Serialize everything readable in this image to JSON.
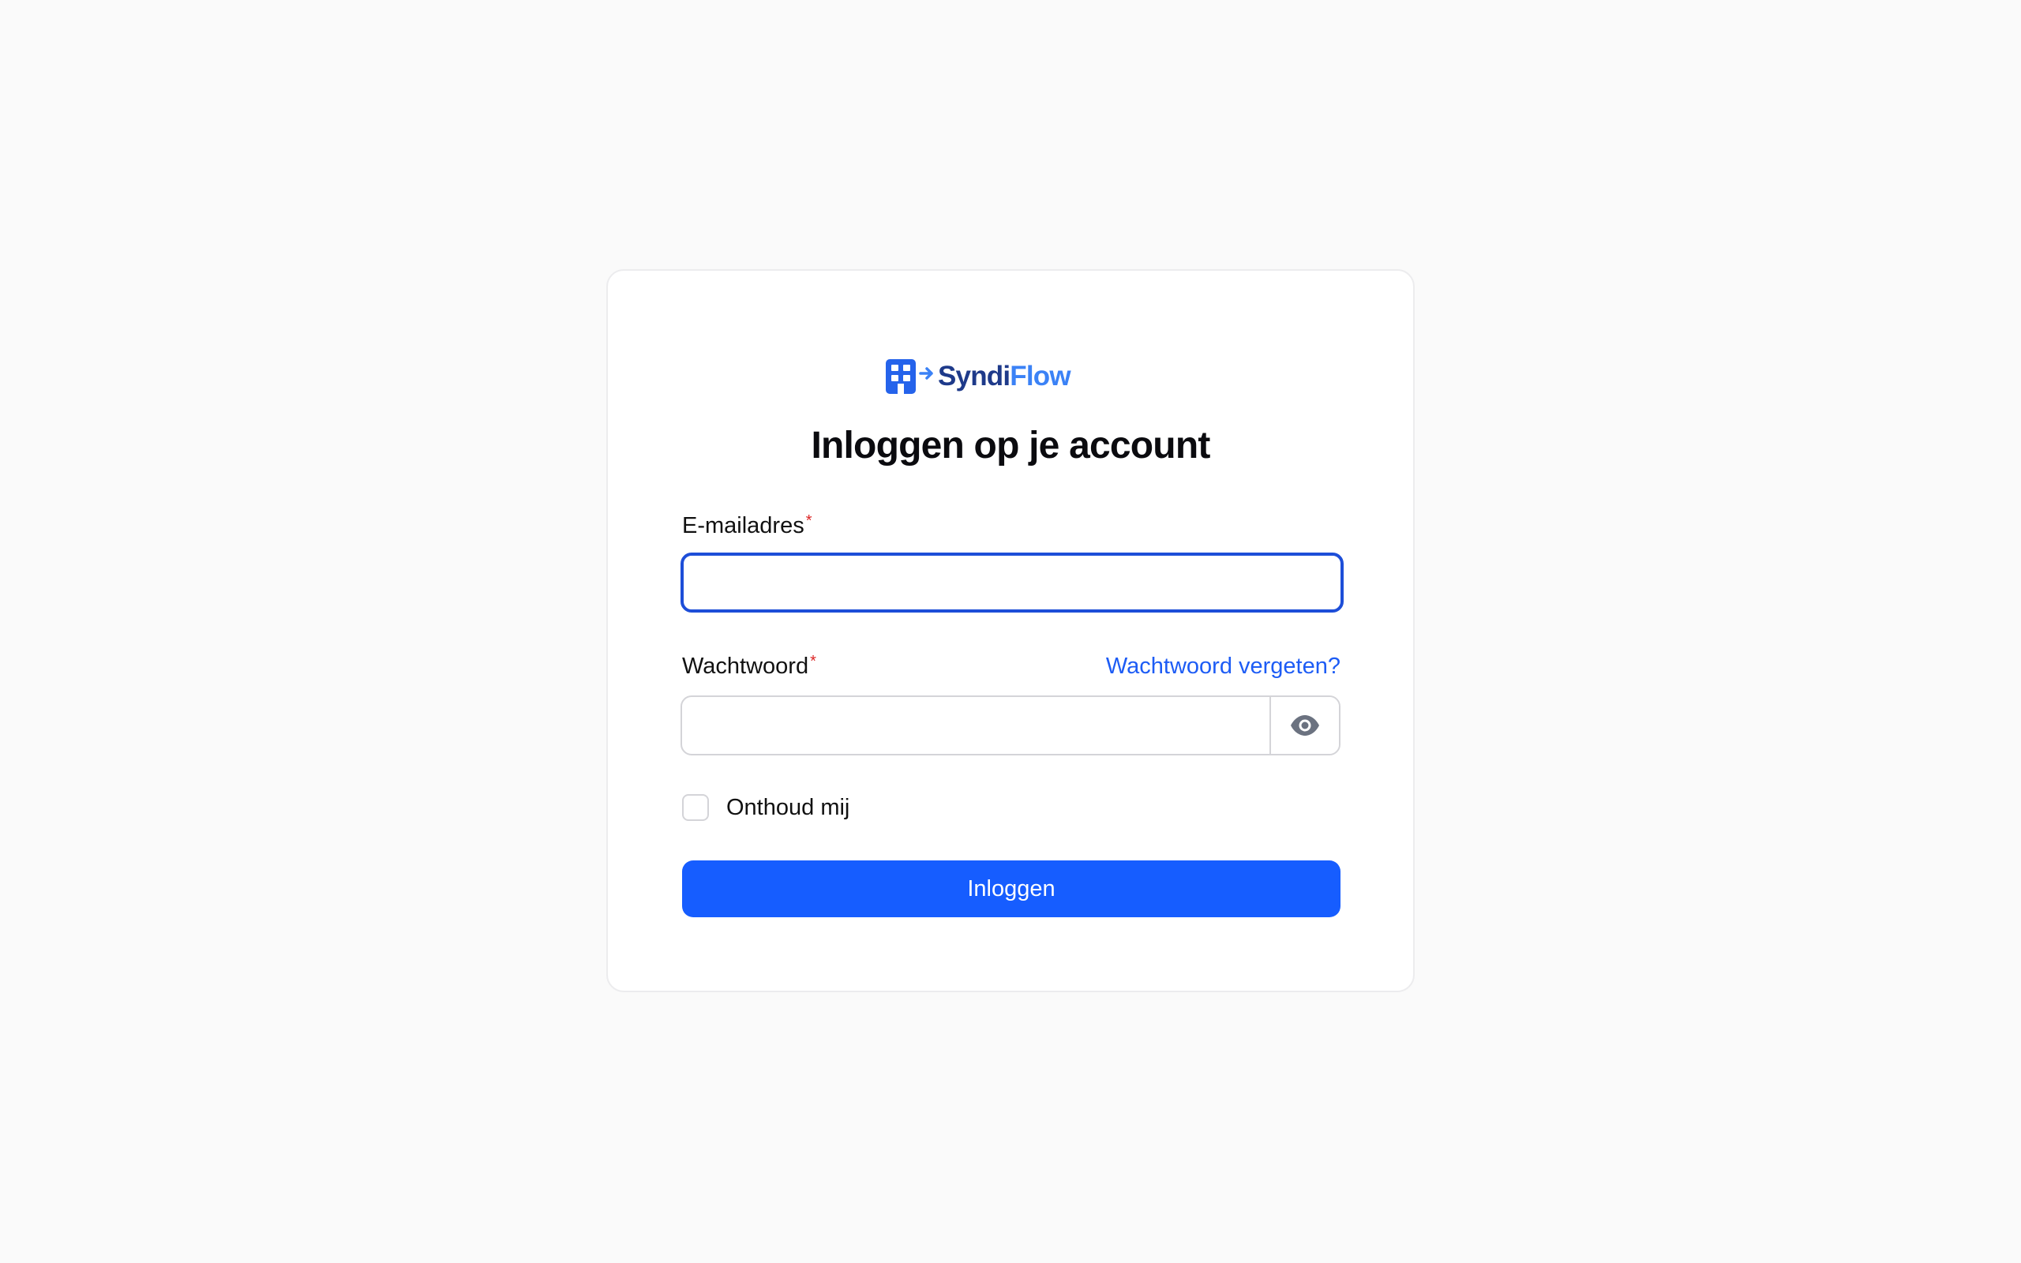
{
  "brand": {
    "name_part1": "Syndi",
    "name_part2": "Flow",
    "logo_icon": "building-arrow-icon",
    "color_dark": "#1e3a8a",
    "color_light": "#3b82f6"
  },
  "page": {
    "title": "Inloggen op je account"
  },
  "form": {
    "email": {
      "label": "E-mailadres",
      "required_mark": "*",
      "value": "",
      "placeholder": ""
    },
    "password": {
      "label": "Wachtwoord",
      "required_mark": "*",
      "value": "",
      "placeholder": "",
      "toggle_icon": "eye-icon"
    },
    "forgot_link": "Wachtwoord vergeten?",
    "remember_label": "Onthoud mij",
    "remember_checked": false,
    "submit_label": "Inloggen"
  },
  "colors": {
    "primary": "#165dff",
    "link": "#1d5cf5",
    "focus_border": "#1d4ed8",
    "required": "#dc2626",
    "background": "#fafafa"
  }
}
